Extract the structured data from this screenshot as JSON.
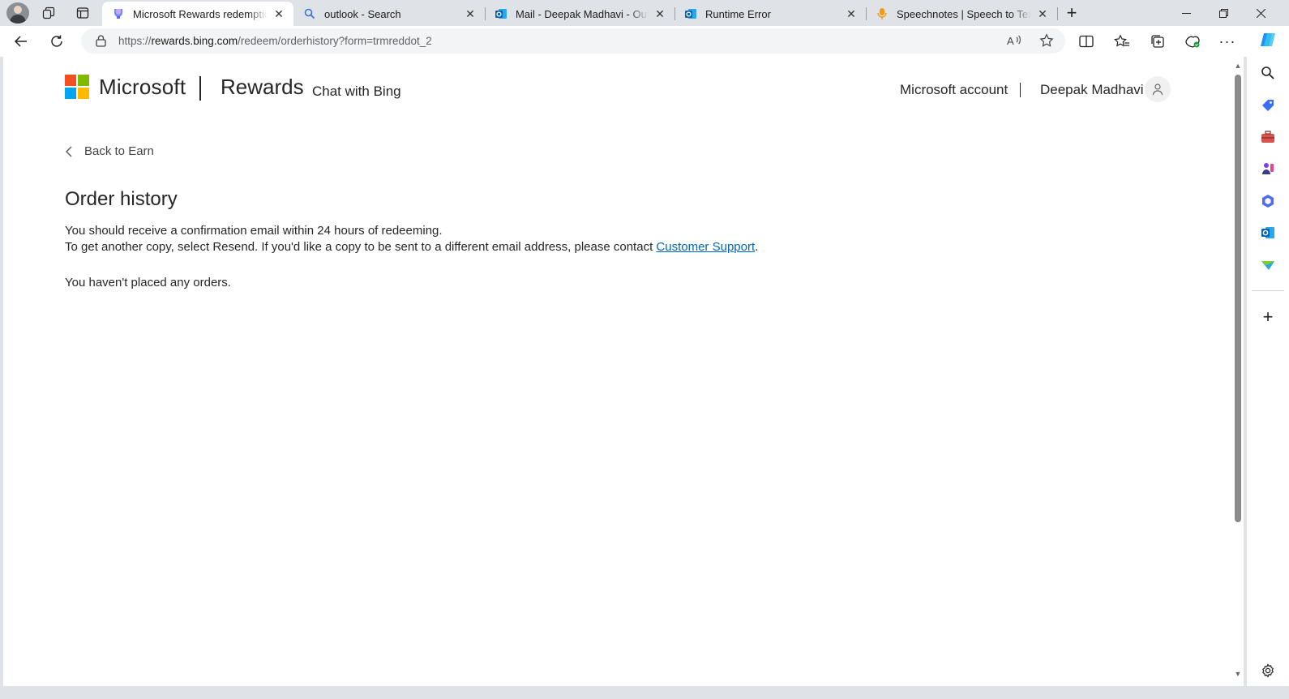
{
  "browser": {
    "tabs": [
      {
        "title": "Microsoft Rewards redemption order history",
        "favicon": "rewards-icon",
        "active": true
      },
      {
        "title": "outlook - Search",
        "favicon": "search-icon",
        "active": false
      },
      {
        "title": "Mail - Deepak Madhavi - Outlook",
        "favicon": "outlook-icon",
        "active": false
      },
      {
        "title": "Runtime Error",
        "favicon": "outlook-icon",
        "active": false
      },
      {
        "title": "Speechnotes | Speech to Text Online",
        "favicon": "microphone-icon",
        "active": false
      }
    ],
    "address": {
      "prefix": "https://",
      "domain": "rewards.bing.com",
      "path": "/redeem/orderhistory?form=trmreddot_2"
    }
  },
  "header": {
    "brand": "Microsoft",
    "product": "Rewards",
    "chat_link": "Chat with Bing",
    "account_link": "Microsoft account",
    "separator": "|",
    "user_name": "Deepak Madhavi"
  },
  "content": {
    "back_label": "Back to Earn",
    "title": "Order history",
    "line1": "You should receive a confirmation email within 24 hours of redeeming.",
    "line2_pre": "To get another copy, select Resend. If you'd like a copy to be sent to a different email address, please contact ",
    "support_link": "Customer Support",
    "line2_post": ".",
    "empty_message": "You haven't placed any orders."
  },
  "colors": {
    "ms_red": "#f25022",
    "ms_green": "#7fba00",
    "ms_blue": "#00a4ef",
    "ms_yellow": "#ffb900",
    "link": "#0067b8"
  }
}
